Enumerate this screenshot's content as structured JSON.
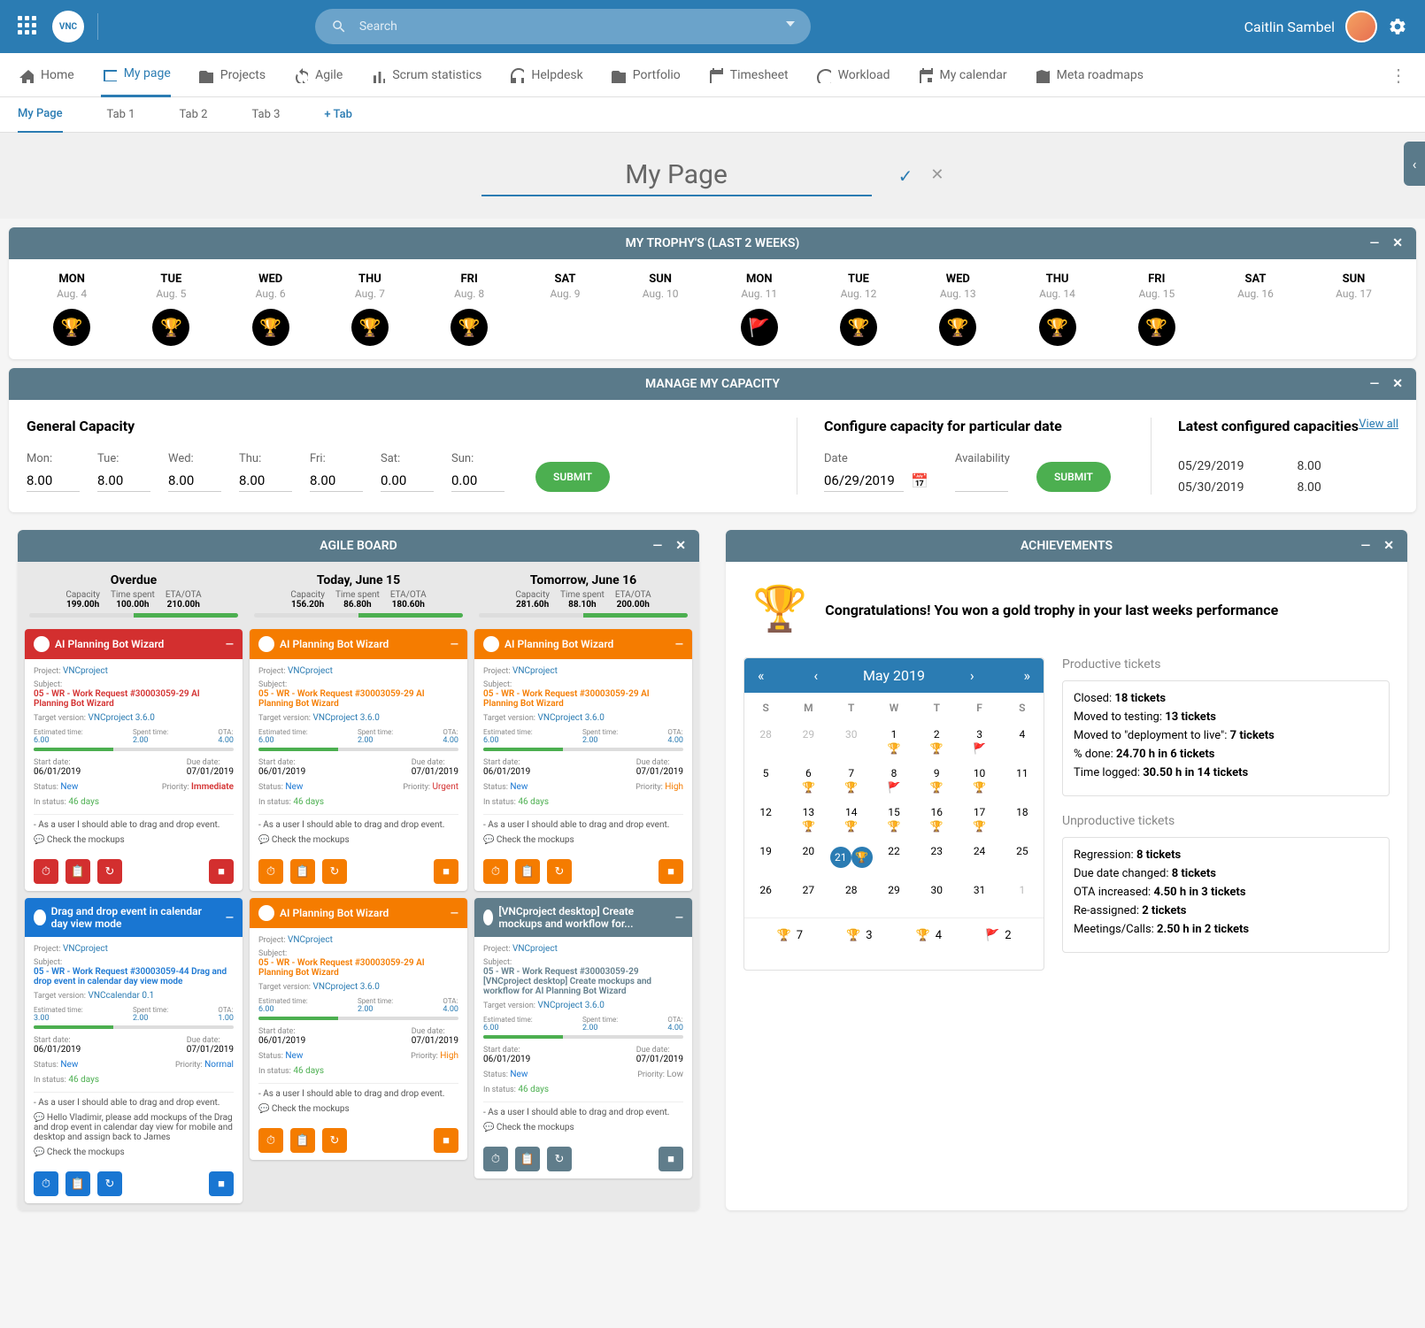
{
  "topbar": {
    "search_placeholder": "Search",
    "username": "Caitlin Sambel"
  },
  "nav": {
    "home": "Home",
    "mypage": "My page",
    "projects": "Projects",
    "agile": "Agile",
    "scrum": "Scrum statistics",
    "helpdesk": "Helpdesk",
    "portfolio": "Portfolio",
    "timesheet": "Timesheet",
    "workload": "Workload",
    "calendar": "My calendar",
    "meta": "Meta roadmaps"
  },
  "tabs": {
    "mypage": "My Page",
    "t1": "Tab 1",
    "t2": "Tab 2",
    "t3": "Tab 3",
    "add": "+ Tab"
  },
  "title_value": "My Page",
  "trophies": {
    "title": "MY TROPHY'S (LAST 2 WEEKS)",
    "days": [
      {
        "d": "MON",
        "dt": "Aug. 4",
        "ic": "🏆",
        "c": "gold"
      },
      {
        "d": "TUE",
        "dt": "Aug. 5",
        "ic": "🏆",
        "c": "gold"
      },
      {
        "d": "WED",
        "dt": "Aug. 6",
        "ic": "🏆",
        "c": "grey"
      },
      {
        "d": "THU",
        "dt": "Aug. 7",
        "ic": "🏆",
        "c": "gold"
      },
      {
        "d": "FRI",
        "dt": "Aug. 8",
        "ic": "🏆",
        "c": "gold"
      },
      {
        "d": "SAT",
        "dt": "Aug. 9",
        "ic": "",
        "c": "none"
      },
      {
        "d": "SUN",
        "dt": "Aug. 10",
        "ic": "",
        "c": "none"
      },
      {
        "d": "MON",
        "dt": "Aug. 11",
        "ic": "🚩",
        "c": "red"
      },
      {
        "d": "TUE",
        "dt": "Aug. 12",
        "ic": "🏆",
        "c": "gold"
      },
      {
        "d": "WED",
        "dt": "Aug. 13",
        "ic": "🏆",
        "c": "grey"
      },
      {
        "d": "THU",
        "dt": "Aug. 14",
        "ic": "🏆",
        "c": "grey"
      },
      {
        "d": "FRI",
        "dt": "Aug. 15",
        "ic": "🏆",
        "c": "gold"
      },
      {
        "d": "SAT",
        "dt": "Aug. 16",
        "ic": "",
        "c": "none"
      },
      {
        "d": "SUN",
        "dt": "Aug. 17",
        "ic": "",
        "c": "none"
      }
    ]
  },
  "capacity": {
    "title": "MANAGE MY CAPACITY",
    "general_heading": "General Capacity",
    "days": [
      {
        "l": "Mon:",
        "v": "8.00"
      },
      {
        "l": "Tue:",
        "v": "8.00"
      },
      {
        "l": "Wed:",
        "v": "8.00"
      },
      {
        "l": "Thu:",
        "v": "8.00"
      },
      {
        "l": "Fri:",
        "v": "8.00"
      },
      {
        "l": "Sat:",
        "v": "0.00"
      },
      {
        "l": "Sun:",
        "v": "0.00"
      }
    ],
    "submit": "SUBMIT",
    "configure_heading": "Configure capacity for particular date",
    "date_label": "Date",
    "date_value": "06/29/2019",
    "avail_label": "Availability",
    "latest_heading": "Latest configured capacities",
    "view_all": "View all",
    "rows": [
      {
        "d": "05/29/2019",
        "v": "8.00"
      },
      {
        "d": "05/30/2019",
        "v": "8.00"
      }
    ]
  },
  "agile": {
    "title": "AGILE BOARD",
    "cols": [
      {
        "title": "Overdue",
        "cap": "199.00h",
        "spent": "100.00h",
        "eta": "210.00h"
      },
      {
        "title": "Today, June 15",
        "cap": "156.20h",
        "spent": "86.80h",
        "eta": "180.60h"
      },
      {
        "title": "Tomorrow, June 16",
        "cap": "281.60h",
        "spent": "88.10h",
        "eta": "200.00h"
      }
    ],
    "stat_labels": {
      "cap": "Capacity",
      "spent": "Time spent",
      "eta": "ETA/OTA"
    },
    "card": {
      "title": "AI Planning Bot Wizard",
      "title2": "Drag and drop event in calendar day view mode",
      "title3": "[VNCproject desktop] Create mockups and workflow for...",
      "proj_lbl": "Project:",
      "proj": "VNCproject",
      "subj_lbl": "Subject:",
      "subj1": "05 - WR - Work Request #30003059-29 AI Planning Bot Wizard",
      "subj2": "05 - WR - Work Request #30003059-44 Drag and drop event in calendar day view mode",
      "subj3": "05 - WR - Work Request #30003059-29 [VNCproject desktop] Create mockups and workflow for AI Planning Bot Wizard",
      "tgt_lbl": "Target version:",
      "tgt": "VNCproject 3.6.0",
      "tgt2": "VNCcalendar 0.1",
      "est_lbl": "Estimated time:",
      "est": "6.00",
      "est2": "3.00",
      "spent_lbl": "Spent time:",
      "spent": "2.00",
      "ota_lbl": "OTA:",
      "ota": "4.00",
      "ota2": "1.00",
      "start_lbl": "Start date:",
      "start": "06/01/2019",
      "due_lbl": "Due date:",
      "due": "07/01/2019",
      "status_lbl": "Status:",
      "status": "New",
      "prio_lbl": "Priority:",
      "prio_imm": "Immediate",
      "prio_urg": "Urgent",
      "prio_high": "High",
      "prio_norm": "Normal",
      "prio_low": "Low",
      "instatus_lbl": "In status:",
      "instatus": "46 days",
      "desc": "- As a user I should able to drag and drop event.",
      "desc2": "Hello Vladimir, please add mockups of the Drag and drop event in calendar day view for mobile and desktop and assign back to James",
      "mock": "Check the mockups"
    }
  },
  "ach": {
    "title": "ACHIEVEMENTS",
    "congrats": "Congratulations! You won a gold trophy in your last weeks performance",
    "cal_month": "May 2019",
    "dow": [
      "S",
      "M",
      "T",
      "W",
      "T",
      "F",
      "S"
    ],
    "summary": [
      {
        "ic": "🏆",
        "v": "7",
        "c": "gold"
      },
      {
        "ic": "🏆",
        "v": "3",
        "c": "grey"
      },
      {
        "ic": "🏆",
        "v": "4",
        "c": "dgold"
      },
      {
        "ic": "🚩",
        "v": "2",
        "c": "red"
      }
    ],
    "prod_h": "Productive tickets",
    "prod": [
      {
        "t": "Closed: ",
        "b": "18 tickets"
      },
      {
        "t": "Moved to testing: ",
        "b": "13 tickets"
      },
      {
        "t": "Moved to \"deployment to live\": ",
        "b": "7 tickets"
      },
      {
        "t": "% done: ",
        "b": "24.70 h in 6 tickets"
      },
      {
        "t": "Time logged: ",
        "b": "30.50 h in 14 tickets"
      }
    ],
    "unprod_h": "Unproductive tickets",
    "unprod": [
      {
        "t": "Regression: ",
        "b": "8 tickets"
      },
      {
        "t": "Due date changed: ",
        "b": "8 tickets"
      },
      {
        "t": "OTA increased: ",
        "b": "4.50 h in 3 tickets"
      },
      {
        "t": "Re-assigned: ",
        "b": "2 tickets"
      },
      {
        "t": "Meetings/Calls: ",
        "b": "2.50 h in 2 tickets"
      }
    ]
  },
  "chart_data": {
    "type": "table",
    "title": "Achievements Calendar May 2019",
    "legend": {
      "gold_trophy": 7,
      "silver_trophy": 3,
      "dark_gold_trophy": 4,
      "red_flag": 2
    },
    "days": [
      {
        "date": 1,
        "icon": "gold_trophy"
      },
      {
        "date": 2,
        "icon": "gold_trophy"
      },
      {
        "date": 3,
        "icon": "red_flag"
      },
      {
        "date": 6,
        "icon": "gold_trophy"
      },
      {
        "date": 7,
        "icon": "gold_trophy"
      },
      {
        "date": 8,
        "icon": "red_flag"
      },
      {
        "date": 9,
        "icon": "silver_trophy"
      },
      {
        "date": 10,
        "icon": "gold_trophy"
      },
      {
        "date": 13,
        "icon": "gold_trophy"
      },
      {
        "date": 14,
        "icon": "silver_trophy"
      },
      {
        "date": 15,
        "icon": "silver_trophy"
      },
      {
        "date": 16,
        "icon": "gold_trophy"
      },
      {
        "date": 17,
        "icon": "gold_trophy"
      },
      {
        "date": 21,
        "icon": "gold_trophy",
        "today": true
      }
    ]
  }
}
